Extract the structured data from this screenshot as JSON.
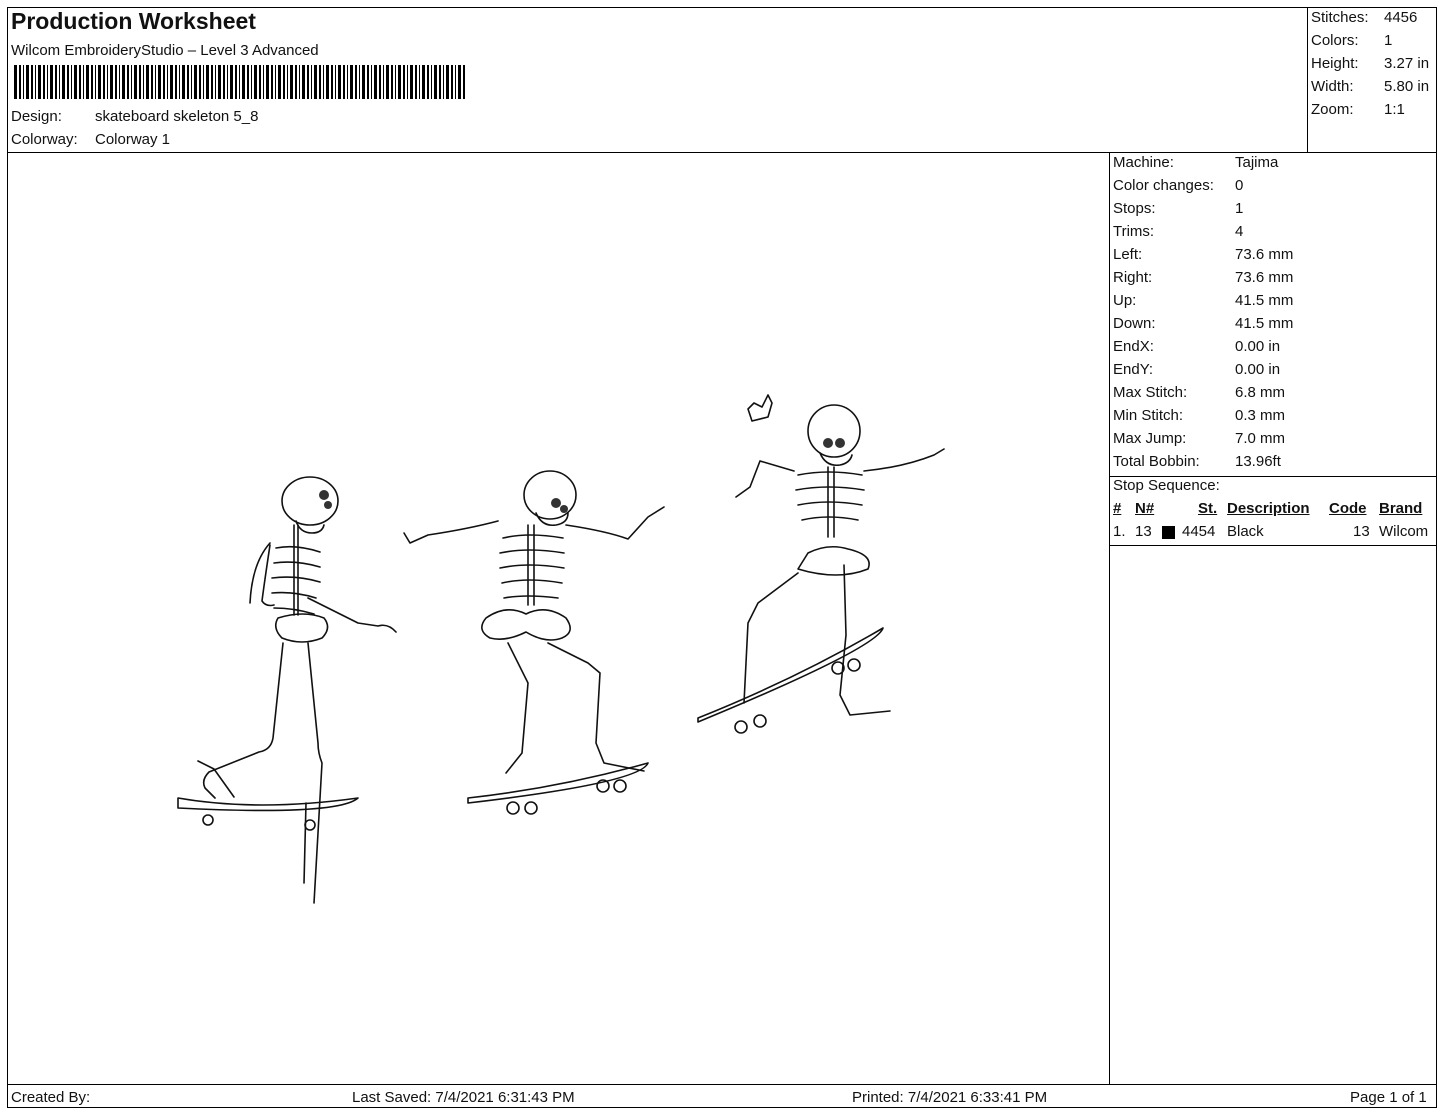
{
  "header": {
    "title": "Production Worksheet",
    "subtitle": "Wilcom EmbroideryStudio – Level 3 Advanced",
    "design_label": "Design:",
    "design_value": "skateboard skeleton 5_8",
    "colorway_label": "Colorway:",
    "colorway_value": "Colorway 1"
  },
  "summary": [
    {
      "label": "Stitches:",
      "value": "4456"
    },
    {
      "label": "Colors:",
      "value": "1"
    },
    {
      "label": "Height:",
      "value": "3.27 in"
    },
    {
      "label": "Width:",
      "value": "5.80 in"
    },
    {
      "label": "Zoom:",
      "value": "1:1"
    }
  ],
  "machine_info": [
    {
      "label": "Machine:",
      "value": "Tajima"
    },
    {
      "label": "Color changes:",
      "value": "0"
    },
    {
      "label": "Stops:",
      "value": "1"
    },
    {
      "label": "Trims:",
      "value": "4"
    },
    {
      "label": "Left:",
      "value": "73.6 mm"
    },
    {
      "label": "Right:",
      "value": "73.6 mm"
    },
    {
      "label": "Up:",
      "value": "41.5 mm"
    },
    {
      "label": "Down:",
      "value": "41.5 mm"
    },
    {
      "label": "EndX:",
      "value": "0.00 in"
    },
    {
      "label": "EndY:",
      "value": "0.00 in"
    },
    {
      "label": "Max Stitch:",
      "value": "6.8 mm"
    },
    {
      "label": "Min Stitch:",
      "value": "0.3 mm"
    },
    {
      "label": "Max Jump:",
      "value": "7.0 mm"
    },
    {
      "label": "Total Bobbin:",
      "value": "13.96ft"
    }
  ],
  "stop_sequence": {
    "title": "Stop Sequence:",
    "columns": [
      "#",
      "N#",
      "St.",
      "Description",
      "Code",
      "Brand"
    ],
    "rows": [
      {
        "num": "1.",
        "n": "13",
        "color": "#000000",
        "stitches": "4454",
        "description": "Black",
        "code": "13",
        "brand": "Wilcom"
      }
    ]
  },
  "footer": {
    "created_by": "Created By:",
    "last_saved": "Last Saved: 7/4/2021 6:31:43 PM",
    "printed": "Printed: 7/4/2021 6:33:41 PM",
    "page": "Page 1 of 1"
  },
  "design_image": "three skeletons riding skateboards (outline embroidery)"
}
